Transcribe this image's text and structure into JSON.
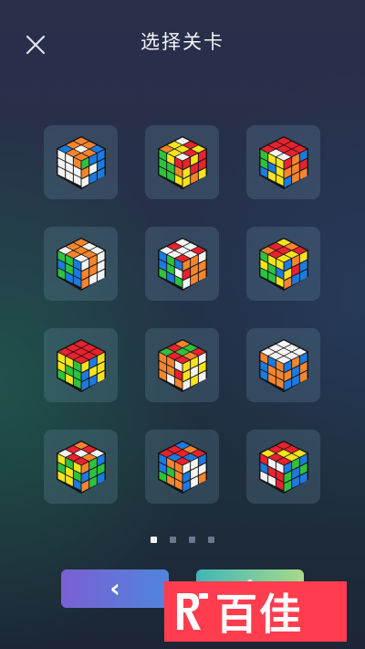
{
  "header": {
    "title": "选择关卡",
    "close_icon": "close-icon"
  },
  "levels": [
    {
      "top": [
        "B",
        "O",
        "O",
        "O",
        "W",
        "O",
        "O",
        "O",
        "B"
      ],
      "left": [
        "W",
        "W",
        "O",
        "W",
        "W",
        "W",
        "W",
        "W",
        "W"
      ],
      "right": [
        "G",
        "B",
        "B",
        "O",
        "W",
        "B",
        "W",
        "B",
        "B"
      ]
    },
    {
      "top": [
        "O",
        "Y",
        "W",
        "Y",
        "Y",
        "R",
        "W",
        "R",
        "Y"
      ],
      "left": [
        "G",
        "Y",
        "R",
        "G",
        "G",
        "O",
        "G",
        "G",
        "Y"
      ],
      "right": [
        "R",
        "Y",
        "R",
        "Y",
        "R",
        "R",
        "Y",
        "O",
        "Y"
      ]
    },
    {
      "top": [
        "R",
        "R",
        "R",
        "W",
        "R",
        "R",
        "W",
        "R",
        "R"
      ],
      "left": [
        "G",
        "Y",
        "Y",
        "G",
        "B",
        "Y",
        "B",
        "Y",
        "Y"
      ],
      "right": [
        "R",
        "O",
        "B",
        "O",
        "O",
        "R",
        "B",
        "O",
        "O"
      ]
    },
    {
      "top": [
        "W",
        "O",
        "O",
        "O",
        "O",
        "W",
        "W",
        "O",
        "W"
      ],
      "left": [
        "G",
        "G",
        "B",
        "B",
        "G",
        "B",
        "G",
        "B",
        "B"
      ],
      "right": [
        "W",
        "O",
        "W",
        "O",
        "O",
        "W",
        "O",
        "W",
        "W"
      ]
    },
    {
      "top": [
        "W",
        "R",
        "W",
        "W",
        "W",
        "W",
        "R",
        "W",
        "R"
      ],
      "left": [
        "B",
        "G",
        "B",
        "B",
        "G",
        "W",
        "G",
        "B",
        "G"
      ],
      "right": [
        "O",
        "O",
        "W",
        "R",
        "O",
        "O",
        "W",
        "O",
        "O"
      ]
    },
    {
      "top": [
        "O",
        "R",
        "Y",
        "R",
        "R",
        "O",
        "Y",
        "Y",
        "R"
      ],
      "left": [
        "G",
        "Y",
        "Y",
        "Y",
        "G",
        "B",
        "G",
        "G",
        "Y"
      ],
      "right": [
        "B",
        "O",
        "Y",
        "Y",
        "R",
        "B",
        "O",
        "B",
        "B"
      ]
    },
    {
      "top": [
        "R",
        "R",
        "R",
        "R",
        "R",
        "R",
        "R",
        "R",
        "R"
      ],
      "left": [
        "Y",
        "Y",
        "G",
        "Y",
        "G",
        "G",
        "G",
        "Y",
        "G"
      ],
      "right": [
        "Y",
        "B",
        "Y",
        "B",
        "Y",
        "Y",
        "B",
        "B",
        "Y"
      ]
    },
    {
      "top": [
        "G",
        "R",
        "O",
        "R",
        "G",
        "G",
        "R",
        "O",
        "R"
      ],
      "left": [
        "O",
        "O",
        "W",
        "O",
        "O",
        "R",
        "O",
        "W",
        "O"
      ],
      "right": [
        "Y",
        "Y",
        "W",
        "Y",
        "W",
        "Y",
        "W",
        "Y",
        "W"
      ]
    },
    {
      "top": [
        "W",
        "W",
        "W",
        "W",
        "W",
        "W",
        "W",
        "W",
        "W"
      ],
      "left": [
        "O",
        "B",
        "O",
        "B",
        "O",
        "O",
        "B",
        "O",
        "O"
      ],
      "right": [
        "B",
        "O",
        "B",
        "O",
        "B",
        "O",
        "B",
        "B",
        "O"
      ]
    },
    {
      "top": [
        "W",
        "R",
        "O",
        "R",
        "W",
        "R",
        "R",
        "O",
        "W"
      ],
      "left": [
        "Y",
        "G",
        "Y",
        "G",
        "Y",
        "G",
        "Y",
        "Y",
        "B"
      ],
      "right": [
        "O",
        "G",
        "B",
        "B",
        "G",
        "G",
        "O",
        "G",
        "B"
      ]
    },
    {
      "top": [
        "R",
        "R",
        "B",
        "B",
        "R",
        "O",
        "R",
        "B",
        "R"
      ],
      "left": [
        "B",
        "O",
        "O",
        "B",
        "G",
        "O",
        "G",
        "O",
        "O"
      ],
      "right": [
        "W",
        "W",
        "B",
        "B",
        "W",
        "W",
        "B",
        "W",
        "O"
      ]
    },
    {
      "top": [
        "Y",
        "R",
        "R",
        "R",
        "Y",
        "R",
        "R",
        "Y",
        "Y"
      ],
      "left": [
        "R",
        "W",
        "W",
        "B",
        "R",
        "R",
        "W",
        "W",
        "R"
      ],
      "right": [
        "B",
        "G",
        "B",
        "G",
        "B",
        "G",
        "G",
        "B",
        "B"
      ]
    }
  ],
  "palette": {
    "W": "#f4f4f4",
    "Y": "#f6e41c",
    "R": "#e8222e",
    "O": "#f7852e",
    "G": "#2ec23e",
    "B": "#1b7be0",
    "body": "#141414"
  },
  "pagination": {
    "pages": 4,
    "current": 1
  },
  "nav": {
    "prev_icon": "chevron-left-icon",
    "next_icon": "chevron-up-icon"
  },
  "watermark": {
    "text": "百佳",
    "color": "#ff3d4e"
  }
}
